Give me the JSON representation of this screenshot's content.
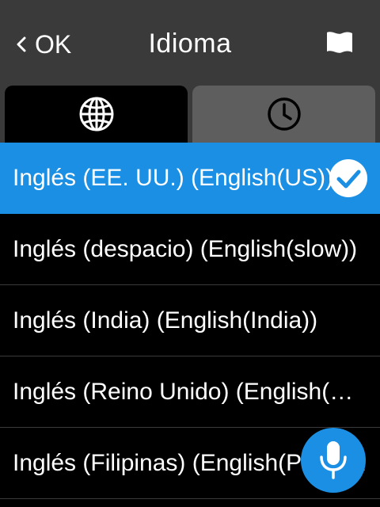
{
  "header": {
    "back_label": "OK",
    "title": "Idioma",
    "flag_icon": "flag-icon"
  },
  "tabs": [
    {
      "icon": "globe-icon",
      "active": true
    },
    {
      "icon": "clock-icon",
      "active": false
    }
  ],
  "languages": [
    {
      "label": "Inglés (EE. UU.) (English(US))",
      "selected": true
    },
    {
      "label": "Inglés (despacio) (English(slow))",
      "selected": false
    },
    {
      "label": "Inglés (India) (English(India))",
      "selected": false
    },
    {
      "label": "Inglés (Reino Unido) (English(UK))",
      "selected": false
    },
    {
      "label": "Inglés (Filipinas) (English(Philippines))",
      "selected": false
    }
  ],
  "colors": {
    "accent": "#1a8fe3",
    "header_bg": "#3a3a3a",
    "inactive_tab": "#5e5e5e",
    "list_bg": "#000000"
  },
  "mic_icon": "microphone-icon"
}
